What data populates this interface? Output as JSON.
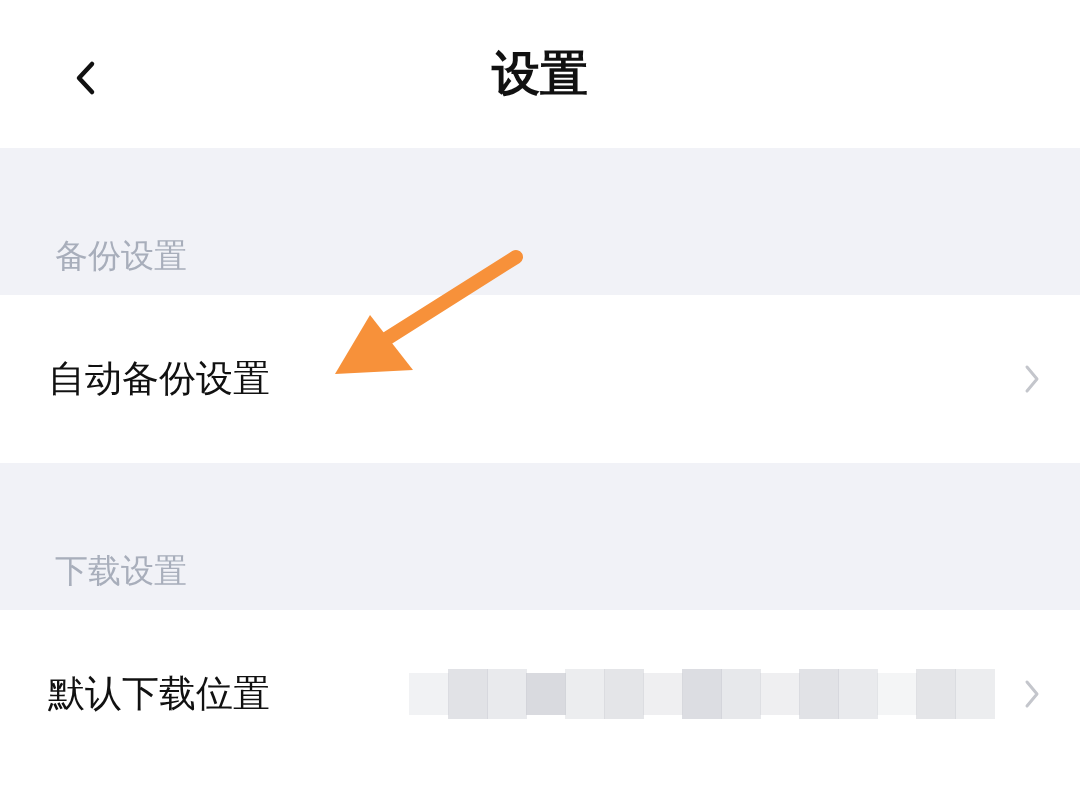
{
  "header": {
    "title": "设置"
  },
  "pointer_arrow": true,
  "sections": [
    {
      "label": "备份设置",
      "rows": [
        {
          "label": "自动备份设置",
          "value_hidden": false
        }
      ]
    },
    {
      "label": "下载设置",
      "rows": [
        {
          "label": "默认下载位置",
          "value_hidden": true
        }
      ]
    }
  ]
}
